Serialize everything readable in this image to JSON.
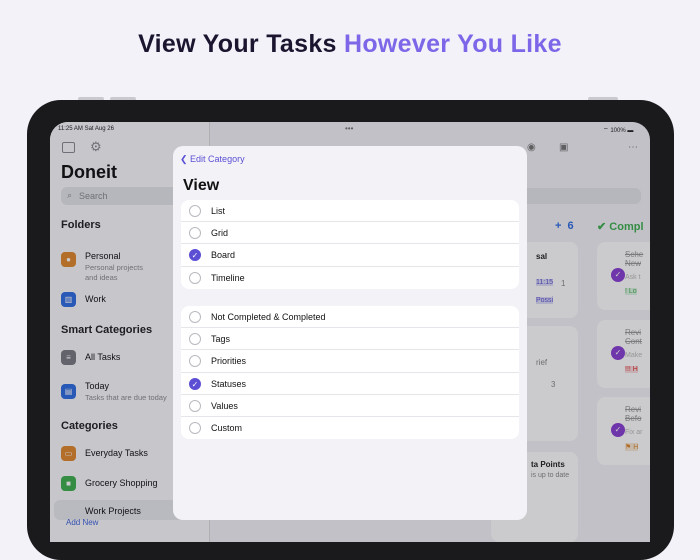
{
  "headline": {
    "part1": "View Your Tasks ",
    "part2": "However You Like"
  },
  "status": {
    "time": "11:25 AM  Sat Aug 26",
    "battery": "100%"
  },
  "sidebar": {
    "title": "Doneit",
    "search_placeholder": "Search",
    "folders_header": "Folders",
    "folders": [
      {
        "label": "Personal",
        "sub1": "Personal projects",
        "sub2": "and ideas"
      },
      {
        "label": "Work"
      }
    ],
    "smart_header": "Smart Categories",
    "smart": [
      {
        "label": "All Tasks"
      },
      {
        "label": "Today",
        "sub1": "Tasks that are due today"
      }
    ],
    "categories_header": "Categories",
    "categories": [
      {
        "label": "Everyday Tasks"
      },
      {
        "label": "Grocery Shopping"
      },
      {
        "label": "Work Projects"
      }
    ],
    "add_new": "Add New"
  },
  "board": {
    "add_count": "6",
    "completed_header": "Compl",
    "frags": [
      "sal",
      "11:15",
      "Possi",
      "1",
      "rief",
      "3",
      "ta Points",
      "is up to date"
    ],
    "done_cards": [
      {
        "t1": "Sche",
        "t2": "New",
        "sub": "Ask t",
        "tag": "! Lo"
      },
      {
        "t1": "Revi",
        "t2": "Cont",
        "sub": "Make",
        "tag": "!!! H"
      },
      {
        "t1": "Revi",
        "t2": "Befo",
        "sub": "Fix ar",
        "tag": "H"
      }
    ]
  },
  "modal": {
    "back_label": "Edit Category",
    "title": "View",
    "layouts": [
      {
        "label": "List",
        "checked": false
      },
      {
        "label": "Grid",
        "checked": false
      },
      {
        "label": "Board",
        "checked": true
      },
      {
        "label": "Timeline",
        "checked": false
      }
    ],
    "groupings": [
      {
        "label": "Not Completed & Completed",
        "checked": false
      },
      {
        "label": "Tags",
        "checked": false
      },
      {
        "label": "Priorities",
        "checked": false
      },
      {
        "label": "Statuses",
        "checked": true
      },
      {
        "label": "Values",
        "checked": false
      },
      {
        "label": "Custom",
        "checked": false
      }
    ]
  }
}
